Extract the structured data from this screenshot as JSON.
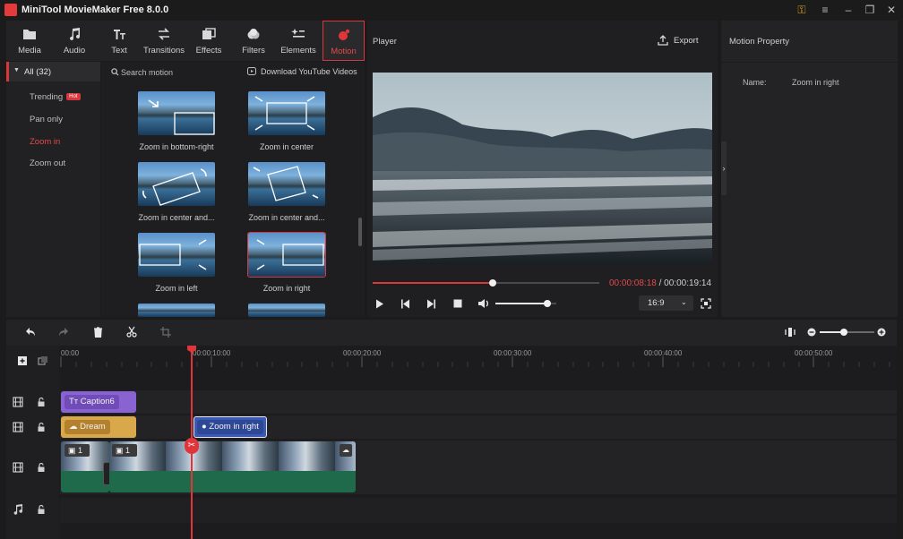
{
  "app": {
    "title": "MiniTool MovieMaker Free 8.0.0"
  },
  "toolbar": {
    "items": [
      {
        "label": "Media",
        "icon": "folder-icon"
      },
      {
        "label": "Audio",
        "icon": "music-note-icon"
      },
      {
        "label": "Text",
        "icon": "text-icon"
      },
      {
        "label": "Transitions",
        "icon": "transitions-icon"
      },
      {
        "label": "Effects",
        "icon": "effects-icon"
      },
      {
        "label": "Filters",
        "icon": "filters-icon"
      },
      {
        "label": "Elements",
        "icon": "elements-icon"
      },
      {
        "label": "Motion",
        "icon": "motion-icon",
        "active": true
      }
    ]
  },
  "categories": {
    "all": "All (32)",
    "trending": "Trending",
    "hot_badge": "Hot",
    "items": [
      "Pan only",
      "Zoom in",
      "Zoom out"
    ],
    "selected": "Zoom in"
  },
  "media": {
    "search_placeholder": "Search motion",
    "download": "Download YouTube Videos",
    "items": [
      {
        "label": "Zoom in bottom-right"
      },
      {
        "label": "Zoom in center"
      },
      {
        "label": "Zoom in center and..."
      },
      {
        "label": "Zoom in center and..."
      },
      {
        "label": "Zoom in left"
      },
      {
        "label": "Zoom in right",
        "selected": true
      }
    ]
  },
  "player": {
    "title": "Player",
    "export": "Export",
    "current_time": "00:00:08:18",
    "separator": " / ",
    "total_time": "00:00:19:14",
    "progress": 0.53,
    "volume": 0.85,
    "aspect": "16:9"
  },
  "property": {
    "title": "Motion Property",
    "name_label": "Name:",
    "name_value": "Zoom in right"
  },
  "timeline": {
    "ruler": [
      "00:00",
      "00:00:10:00",
      "00:00:20:00",
      "00:00:30:00",
      "00:00:40:00",
      "00:00:50:00"
    ],
    "zoom": 0.45,
    "clips": {
      "caption": "Caption6",
      "dream": "Dream",
      "motion": "Zoom in right",
      "video_index_1": "1",
      "video_index_2": "1"
    }
  },
  "colors": {
    "accent": "#d9363e",
    "caption": "#8a63d2",
    "effect": "#d9a84a",
    "motion": "#3a5ab8",
    "video": "#1f6a4a"
  }
}
